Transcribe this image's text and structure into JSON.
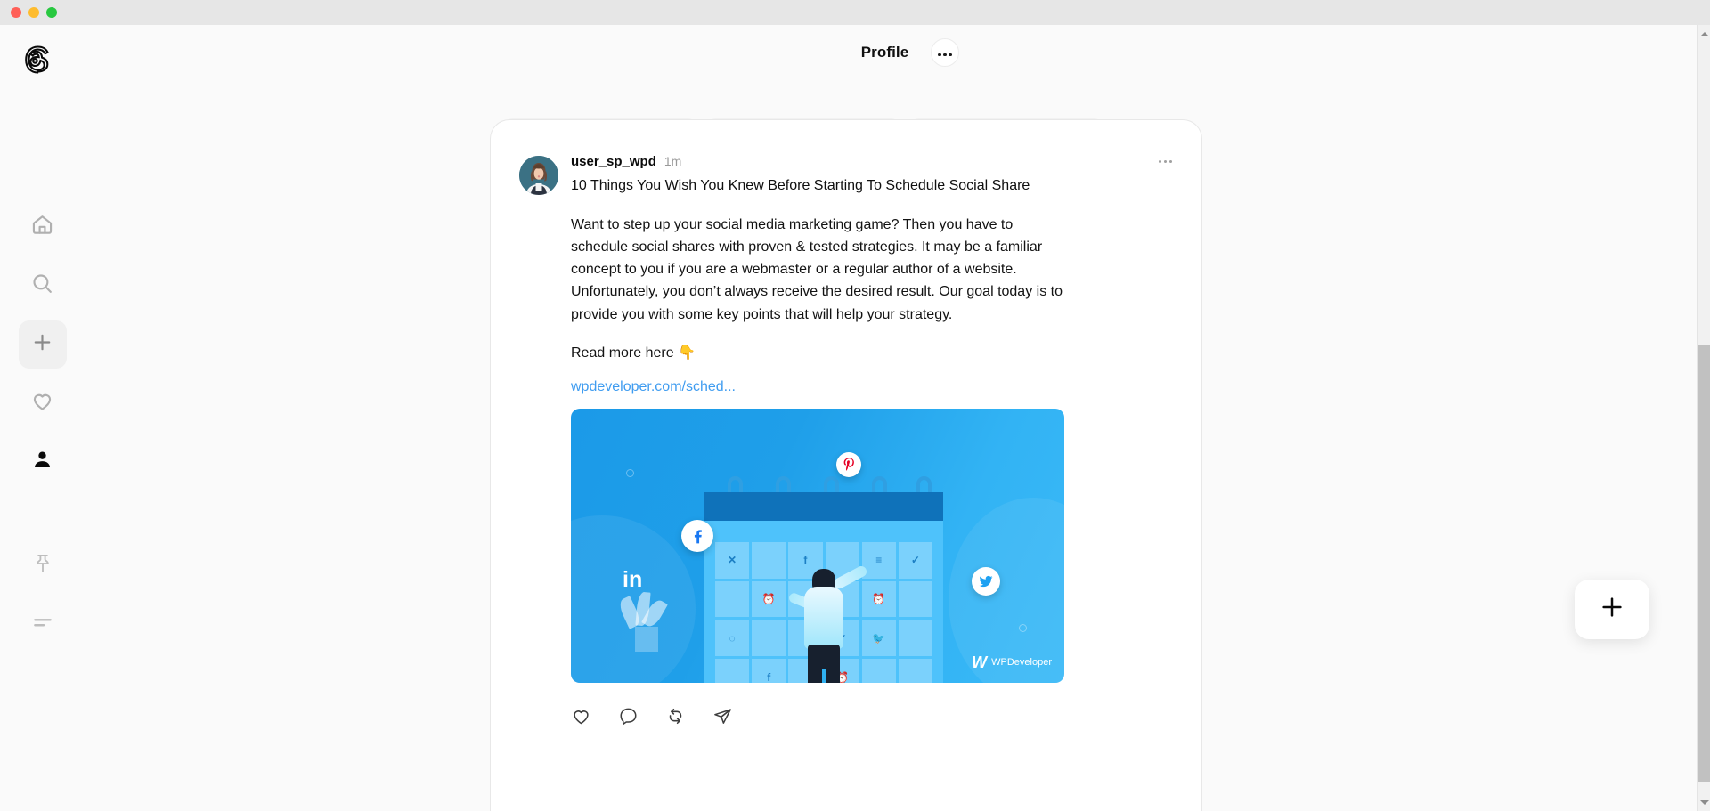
{
  "window": {
    "traffic_lights": [
      "close",
      "minimize",
      "maximize"
    ],
    "colors": {
      "close": "#ff5f57",
      "minimize": "#febc2e",
      "maximize": "#28c840"
    }
  },
  "sidebar": {
    "logo": "threads-logo",
    "items": [
      {
        "name": "home",
        "icon": "home-icon",
        "active": false
      },
      {
        "name": "search",
        "icon": "search-icon",
        "active": false
      },
      {
        "name": "create",
        "icon": "plus-icon",
        "active": true
      },
      {
        "name": "activity",
        "icon": "heart-icon",
        "active": false
      },
      {
        "name": "profile",
        "icon": "person-icon",
        "active": true
      }
    ],
    "bottom_items": [
      {
        "name": "pinned",
        "icon": "pin-icon"
      },
      {
        "name": "menu",
        "icon": "hamburger-icon"
      }
    ]
  },
  "header": {
    "title": "Profile",
    "menu_icon": "ellipsis-icon"
  },
  "post": {
    "username": "user_sp_wpd",
    "timestamp": "1m",
    "menu_icon": "ellipsis-icon",
    "title": "10 Things You Wish You Knew Before Starting To Schedule Social Share",
    "body": "Want to step up your social media marketing game? Then you have to schedule social shares with proven & tested strategies. It may be a familiar concept to you if you are a webmaster or a regular author of a website. Unfortunately, you don’t always receive the desired result. Our goal today is to provide you with some key points that will help your strategy.",
    "read_more": "Read more here",
    "read_more_emoji": "👇",
    "link": "wpdeveloper.com/sched...",
    "link_color": "#3f9cf0",
    "avatar": "user-avatar",
    "media": {
      "alt": "social-share-scheduling-illustration",
      "background_color": "#1f9fe9",
      "watermark_mark": "W",
      "watermark_text": "WPDeveloper",
      "calendar_cells": [
        "✕",
        "",
        "f",
        "",
        "≡",
        "✓",
        "",
        "⏰",
        "",
        "",
        "⏰",
        "",
        "◌",
        "",
        "",
        "✓",
        "🐦",
        "",
        "",
        "f",
        "",
        "⏰",
        "",
        ""
      ],
      "floating_badges": [
        "pinterest-icon",
        "facebook-icon",
        "twitter-icon"
      ],
      "side_label": "in"
    },
    "actions": [
      {
        "name": "like",
        "icon": "heart-icon"
      },
      {
        "name": "reply",
        "icon": "comment-icon"
      },
      {
        "name": "repost",
        "icon": "repost-icon"
      },
      {
        "name": "share",
        "icon": "send-icon"
      }
    ]
  },
  "fab": {
    "icon": "plus-icon",
    "label": "+"
  },
  "scrollbar": {
    "up_icon": "caret-up-icon",
    "down_icon": "caret-down-icon"
  }
}
